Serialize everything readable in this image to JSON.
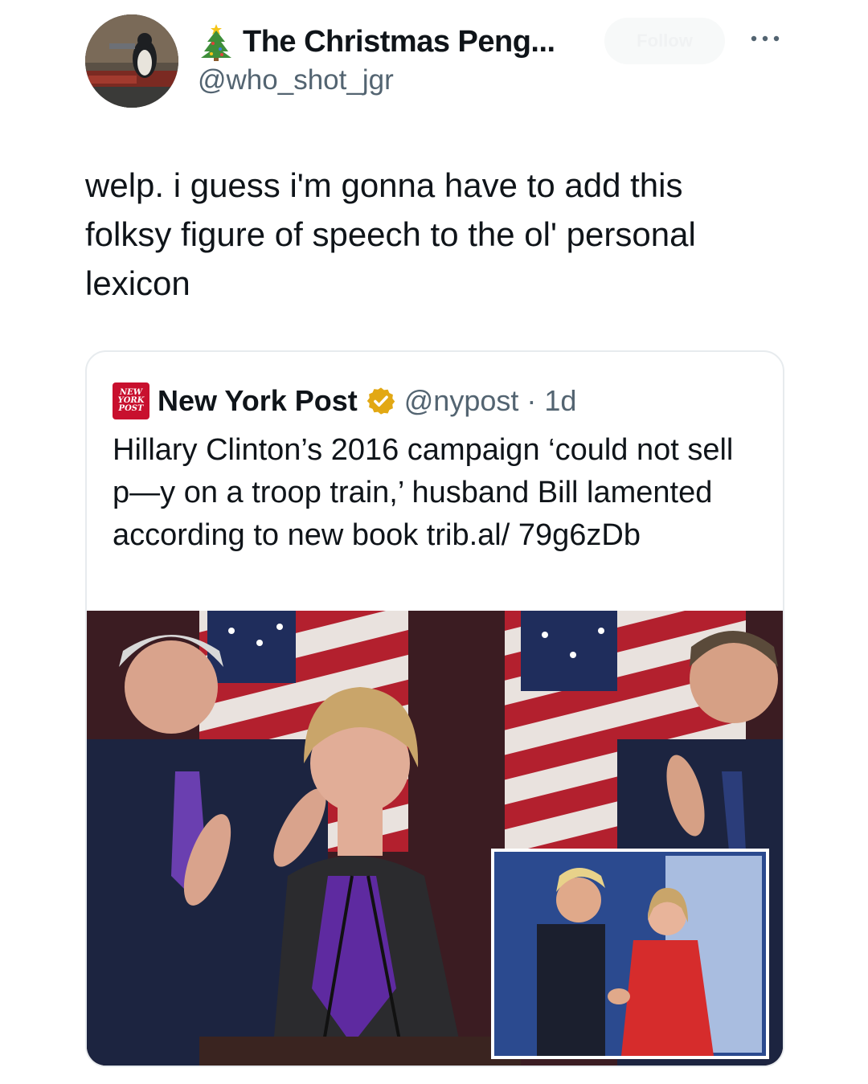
{
  "user": {
    "display_name": "The Christmas Peng...",
    "handle": "@who_shot_jgr",
    "name_emoji_icon": "christmas-tree-icon",
    "follow_label": "Follow"
  },
  "tweet": {
    "text": "welp. i guess i'm gonna have to add this folksy figure of speech to the ol' personal lexicon"
  },
  "quote": {
    "logo_lines": [
      "NEW",
      "YORK",
      "POST"
    ],
    "name": "New York Post",
    "handle": "@nypost",
    "separator": "·",
    "time": "1d",
    "verified_color": "#e2a814",
    "text": "Hillary Clinton’s 2016 campaign ‘could not sell p—y on a troop train,’ husband Bill lamented according to new book trib.al/ 79g6zDb"
  },
  "colors": {
    "text_primary": "#0f1419",
    "text_secondary": "#536471",
    "nyp_red": "#c8102e",
    "card_border": "#e7ebee"
  }
}
